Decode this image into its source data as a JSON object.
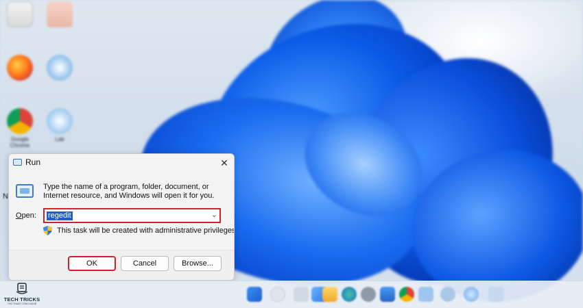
{
  "desktop": {
    "icons": [
      {
        "name": "recycle-bin-icon",
        "label": ""
      },
      {
        "name": "folder-icon",
        "label": ""
      },
      {
        "name": "firefox-icon",
        "label": ""
      },
      {
        "name": "app-icon",
        "label": ""
      },
      {
        "name": "chrome-icon",
        "label": "Google Chrome"
      },
      {
        "name": "app-icon-2",
        "label": "Lab"
      }
    ],
    "stray_text": "N"
  },
  "run_dialog": {
    "title": "Run",
    "description": "Type the name of a program, folder, document, or Internet resource, and Windows will open it for you.",
    "open_label_prefix": "",
    "open_label_underlined": "O",
    "open_label_rest": "pen:",
    "open_value": "regedit",
    "admin_note": "This task will be created with administrative privileges.",
    "buttons": {
      "ok": "OK",
      "cancel": "Cancel",
      "browse": "Browse..."
    },
    "close_glyph": "✕",
    "dropdown_glyph": "⌄"
  },
  "taskbar": {
    "icons": [
      "start-icon",
      "search-icon",
      "task-view-icon",
      "widgets-icon",
      "file-explorer-icon",
      "edge-icon",
      "settings-icon",
      "store-icon",
      "chrome-icon",
      "mail-icon",
      "app-icon",
      "photos-icon",
      "app-icon-2"
    ]
  },
  "watermark": {
    "title": "TECH TRICKS",
    "subtitle": "THỦ THUẬT CÔNG NGHỆ"
  },
  "colors": {
    "highlight_red": "#d21f2b",
    "selection_blue": "#1f5fc9",
    "wallpaper_blue": "#0b5ce8"
  }
}
